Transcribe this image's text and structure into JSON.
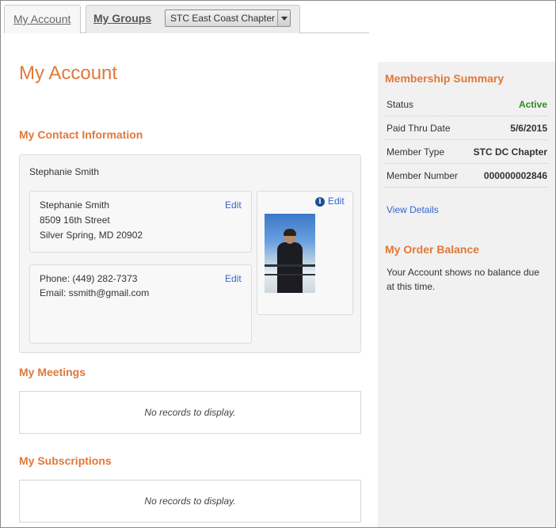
{
  "tabs": [
    {
      "label": "My Account"
    },
    {
      "label": "My Groups",
      "selected_group": "STC East Coast Chapter"
    }
  ],
  "page_title": "My Account",
  "contact": {
    "section_title": "My Contact Information",
    "name": "Stephanie Smith",
    "address": {
      "name": "Stephanie Smith",
      "street": "8509 16th Street",
      "city_line": "Silver Spring, MD 20902",
      "edit_label": "Edit"
    },
    "phone_email": {
      "phone": "Phone: (449) 282-7373",
      "email": "Email: ssmith@gmail.com",
      "edit_label": "Edit"
    },
    "photo": {
      "edit_label": "Edit",
      "info_glyph": "i"
    }
  },
  "meetings": {
    "title": "My Meetings",
    "empty_message": "No records to display."
  },
  "subscriptions": {
    "title": "My Subscriptions",
    "empty_message": "No records to display."
  },
  "membership_summary": {
    "title": "Membership Summary",
    "rows": [
      {
        "label": "Status",
        "value": "Active"
      },
      {
        "label": "Paid Thru Date",
        "value": "5/6/2015"
      },
      {
        "label": "Member Type",
        "value": "STC DC Chapter"
      },
      {
        "label": "Member Number",
        "value": "000000002846"
      }
    ],
    "view_details": "View Details"
  },
  "order_balance": {
    "title": "My Order Balance",
    "text": "Your Account shows no balance due at this time."
  },
  "colors": {
    "accent": "#e0783b",
    "link": "#3366cc",
    "active_status": "#2e8b20"
  }
}
